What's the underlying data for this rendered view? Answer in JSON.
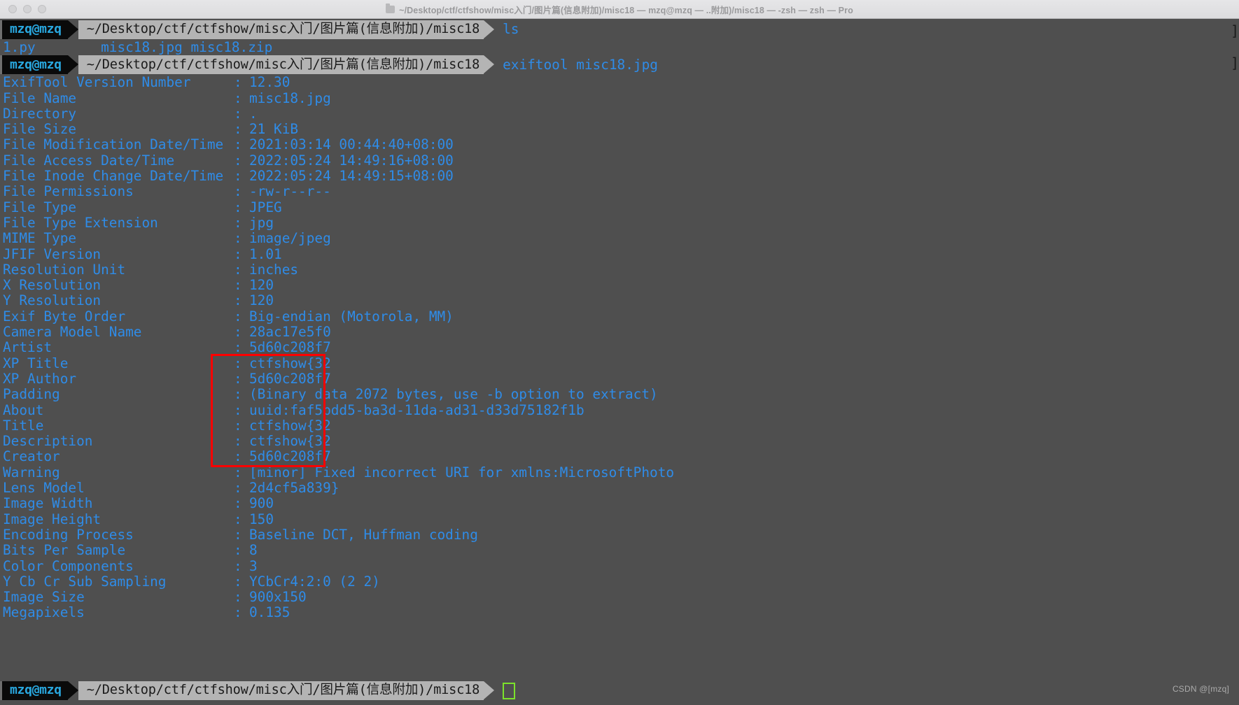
{
  "window": {
    "title": "~/Desktop/ctf/ctfshow/misc入门/图片篇(信息附加)/misc18 — mzq@mzq — ..附加)/misc18 — -zsh — zsh — Pro",
    "folder_icon": "folder-icon",
    "traffic_lights": [
      "close",
      "minimize",
      "zoom"
    ]
  },
  "session": {
    "user_host": "mzq@mzq",
    "path": "~/Desktop/ctf/ctfshow/misc入门/图片篇(信息附加)/misc18",
    "command_1": "ls",
    "ls_output": "1.py        misc18.jpg misc18.zip",
    "command_2": "exiftool misc18.jpg",
    "cursor": "block-cursor"
  },
  "exif": [
    {
      "key": "ExifTool Version Number",
      "colon": ":",
      "value": "12.30"
    },
    {
      "key": "File Name",
      "colon": ":",
      "value": "misc18.jpg"
    },
    {
      "key": "Directory",
      "colon": ":",
      "value": "."
    },
    {
      "key": "File Size",
      "colon": ":",
      "value": "21 KiB"
    },
    {
      "key": "File Modification Date/Time",
      "colon": ":",
      "value": "2021:03:14 00:44:40+08:00"
    },
    {
      "key": "File Access Date/Time",
      "colon": ":",
      "value": "2022:05:24 14:49:16+08:00"
    },
    {
      "key": "File Inode Change Date/Time",
      "colon": ":",
      "value": "2022:05:24 14:49:15+08:00"
    },
    {
      "key": "File Permissions",
      "colon": ":",
      "value": "-rw-r--r--"
    },
    {
      "key": "File Type",
      "colon": ":",
      "value": "JPEG"
    },
    {
      "key": "File Type Extension",
      "colon": ":",
      "value": "jpg"
    },
    {
      "key": "MIME Type",
      "colon": ":",
      "value": "image/jpeg"
    },
    {
      "key": "JFIF Version",
      "colon": ":",
      "value": "1.01"
    },
    {
      "key": "Resolution Unit",
      "colon": ":",
      "value": "inches"
    },
    {
      "key": "X Resolution",
      "colon": ":",
      "value": "120"
    },
    {
      "key": "Y Resolution",
      "colon": ":",
      "value": "120"
    },
    {
      "key": "Exif Byte Order",
      "colon": ":",
      "value": "Big-endian (Motorola, MM)"
    },
    {
      "key": "Camera Model Name",
      "colon": ":",
      "value": "28ac17e5f0"
    },
    {
      "key": "Artist",
      "colon": ":",
      "value": "5d60c208f7"
    },
    {
      "key": "XP Title",
      "colon": ":",
      "value": "ctfshow{32"
    },
    {
      "key": "XP Author",
      "colon": ":",
      "value": "5d60c208f7"
    },
    {
      "key": "Padding",
      "colon": ":",
      "value": "(Binary data 2072 bytes, use -b option to extract)"
    },
    {
      "key": "About",
      "colon": ":",
      "value": "uuid:faf5bdd5-ba3d-11da-ad31-d33d75182f1b"
    },
    {
      "key": "Title",
      "colon": ":",
      "value": "ctfshow{32"
    },
    {
      "key": "Description",
      "colon": ":",
      "value": "ctfshow{32"
    },
    {
      "key": "Creator",
      "colon": ":",
      "value": "5d60c208f7"
    },
    {
      "key": "Warning",
      "colon": ":",
      "value": "[minor] Fixed incorrect URI for xmlns:MicrosoftPhoto"
    },
    {
      "key": "Lens Model",
      "colon": ":",
      "value": "2d4cf5a839}"
    },
    {
      "key": "Image Width",
      "colon": ":",
      "value": "900"
    },
    {
      "key": "Image Height",
      "colon": ":",
      "value": "150"
    },
    {
      "key": "Encoding Process",
      "colon": ":",
      "value": "Baseline DCT, Huffman coding"
    },
    {
      "key": "Bits Per Sample",
      "colon": ":",
      "value": "8"
    },
    {
      "key": "Color Components",
      "colon": ":",
      "value": "3"
    },
    {
      "key": "Y Cb Cr Sub Sampling",
      "colon": ":",
      "value": "YCbCr4:2:0 (2 2)"
    },
    {
      "key": "Image Size",
      "colon": ":",
      "value": "900x150"
    },
    {
      "key": "Megapixels",
      "colon": ":",
      "value": "0.135"
    }
  ],
  "annotation": {
    "type": "red-rectangle",
    "color": "#fe0000",
    "highlights": [
      "ctfshow{32",
      "5d60c208f7",
      "(Binary data 2072 bytes, use -b option to extract)",
      "uuid:faf5bdd5-ba3d-11da-ad31-d33d75182f1b",
      "ctfshow{32",
      "ctfshow{32",
      "5d60c208f7"
    ]
  },
  "watermark": "CSDN @[mzq]",
  "colors": {
    "terminal_bg": "#4f4f4f",
    "text_blue": "#2f8ce8",
    "prompt_user_bg": "#0a0a0a",
    "prompt_user_fg": "#29a8e0",
    "prompt_path_bg": "#b4b4b4",
    "prompt_path_fg": "#1b1b1b",
    "cursor_green": "#7ce22b",
    "annotation_red": "#fe0000"
  }
}
